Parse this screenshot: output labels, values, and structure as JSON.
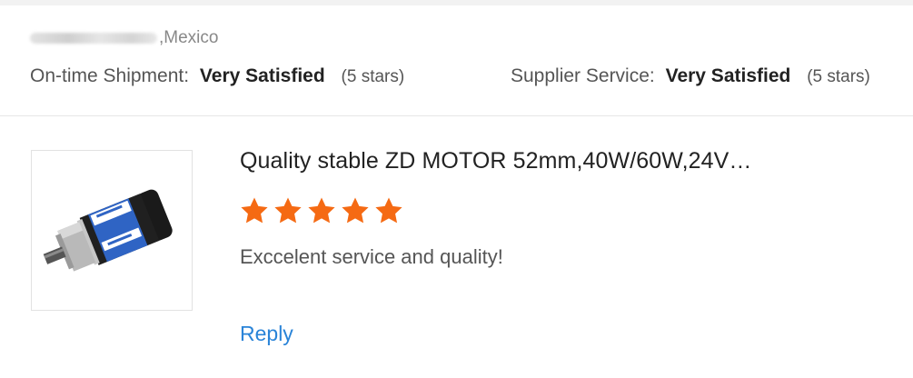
{
  "review": {
    "location_suffix": ",Mexico",
    "ratings": [
      {
        "label": "On-time Shipment:",
        "value": "Very Satisfied",
        "stars": "(5 stars)"
      },
      {
        "label": "Supplier Service:",
        "value": "Very Satisfied",
        "stars": "(5 stars)"
      }
    ]
  },
  "product": {
    "title": "Quality stable ZD MOTOR 52mm,40W/60W,24V…",
    "rating_stars": 5,
    "star_color": "#f56a13",
    "comment": "Exccelent service and quality!",
    "reply_label": "Reply",
    "link_color": "#2a84d8"
  }
}
